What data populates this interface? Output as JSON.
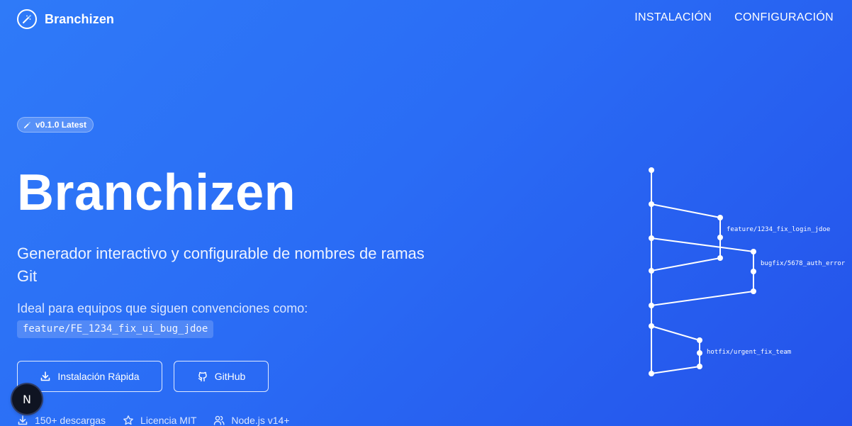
{
  "header": {
    "brand": "Branchizen",
    "nav": [
      {
        "label": "INSTALACIÓN"
      },
      {
        "label": "CONFIGURACIÓN"
      }
    ]
  },
  "badge": {
    "label": "v0.1.0 Latest"
  },
  "hero": {
    "title": "Branchizen",
    "subtitle": "Generador interactivo y configurable de nombres de ramas Git",
    "description": "Ideal para equipos que siguen convenciones como:",
    "example_branch": "feature/FE_1234_fix_ui_bug_jdoe"
  },
  "buttons": {
    "install_label": "Instalación Rápida",
    "github_label": "GitHub"
  },
  "stats": [
    {
      "label": "150+ descargas",
      "icon": "download-icon"
    },
    {
      "label": "Licencia MIT",
      "icon": "star-icon"
    },
    {
      "label": "Node.js v14+",
      "icon": "users-icon"
    }
  ],
  "graph": {
    "branches": [
      {
        "label": "feature/1234_fix_login_jdoe"
      },
      {
        "label": "bugfix/5678_auth_error"
      },
      {
        "label": "hotfix/urgent_fix_team"
      }
    ]
  },
  "floating_button": {
    "label": "N"
  },
  "colors": {
    "background_start": "#2f7af8",
    "background_end": "#2452ea",
    "text": "#ffffff"
  }
}
